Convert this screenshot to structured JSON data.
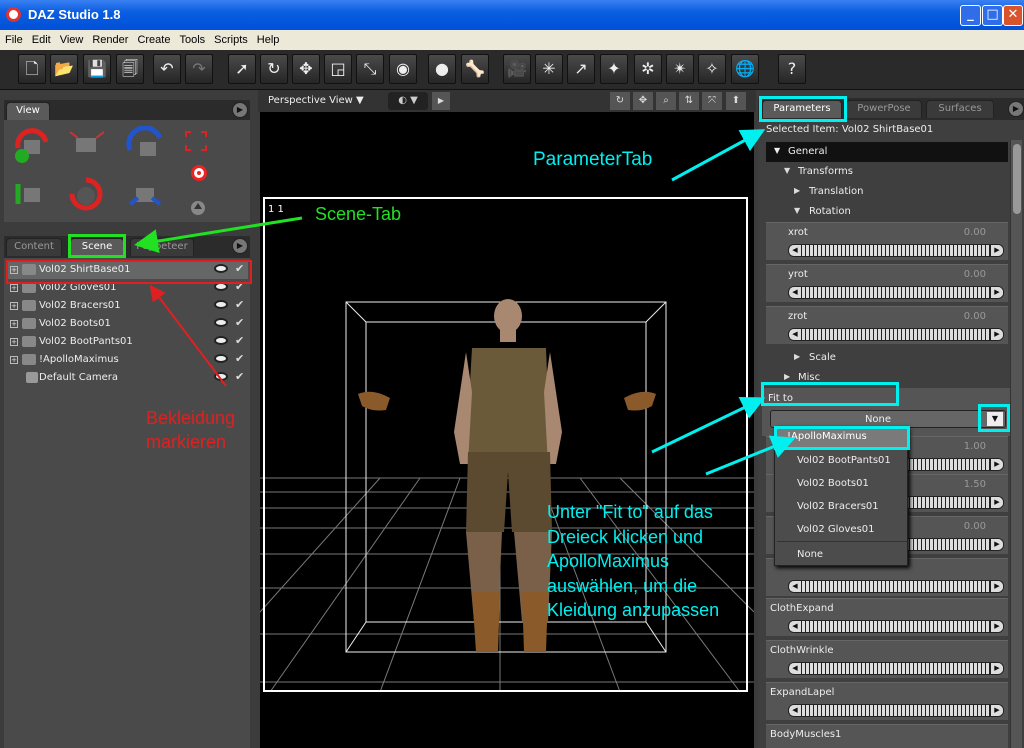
{
  "window": {
    "title": "DAZ Studio 1.8"
  },
  "menu": [
    "File",
    "Edit",
    "View",
    "Render",
    "Create",
    "Tools",
    "Scripts",
    "Help"
  ],
  "colors": {
    "cyan": "#00f0f0",
    "green": "#22e022",
    "red": "#e02020",
    "panel": "#4a4a4a"
  },
  "toolbar_icons": [
    "new-icon",
    "open-icon",
    "save-icon",
    "save-as-icon",
    "undo-icon",
    "redo-icon",
    "select-arrow-icon",
    "rotate-icon",
    "move-icon",
    "scale-icon",
    "universal-icon",
    "camera-orbit-icon",
    "sphere-icon",
    "bone-icon",
    "camera-icon",
    "spotlight-icon",
    "distant-light-icon",
    "point-light-icon",
    "light-icon",
    "mag-light-icon",
    "morph-light-icon",
    "globe-icon",
    "help-icon"
  ],
  "view_panel": {
    "tab": "View"
  },
  "scene_panel": {
    "tabs": [
      "Content",
      "Scene",
      "Puppeteer"
    ],
    "items": [
      {
        "name": "Vol02 ShirtBase01",
        "selected": true
      },
      {
        "name": "Vol02 Gloves01",
        "selected": false
      },
      {
        "name": "Vol02 Bracers01",
        "selected": false
      },
      {
        "name": "Vol02 Boots01",
        "selected": false
      },
      {
        "name": "Vol02 BootPants01",
        "selected": false
      },
      {
        "name": "!ApolloMaximus",
        "selected": false
      },
      {
        "name": "Default Camera",
        "selected": false
      }
    ]
  },
  "viewport": {
    "view_label": "Perspective View",
    "corner_label": "1 1"
  },
  "params_panel": {
    "tabs": [
      "Parameters",
      "PowerPose",
      "Surfaces"
    ],
    "selected_item": "Selected Item: Vol02 ShirtBase01",
    "tree": {
      "general": "General",
      "transforms": "Transforms",
      "translation": "Translation",
      "rotation": "Rotation",
      "scale": "Scale",
      "misc": "Misc"
    },
    "rotation_sliders": [
      {
        "label": "xrot",
        "value": "0.00"
      },
      {
        "label": "yrot",
        "value": "0.00"
      },
      {
        "label": "zrot",
        "value": "0.00"
      }
    ],
    "fit_to_label": "Fit to",
    "fit_to_value": "None",
    "dropdown_options": [
      "!ApolloMaximus",
      "Vol02 BootPants01",
      "Vol02 Boots01",
      "Vol02 Bracers01",
      "Vol02 Gloves01",
      "None"
    ],
    "partial_values": [
      "1.00",
      "1.50",
      "0.00"
    ],
    "lower_sliders": [
      {
        "label": "ClothExpand"
      },
      {
        "label": "ClothWrinkle"
      },
      {
        "label": "ExpandLapel"
      },
      {
        "label": "BodyMuscles1"
      }
    ]
  },
  "annotations": {
    "parameter_tab": "ParameterTab",
    "scene_tab": "Scene-Tab",
    "mark_clothing": [
      "Bekleidung",
      "markieren"
    ],
    "instruction": [
      "Unter \"Fit to\" auf das",
      "Dreieck klicken und",
      "ApolloMaximus",
      "auswählen, um die",
      "Kleidung anzupassen"
    ]
  }
}
